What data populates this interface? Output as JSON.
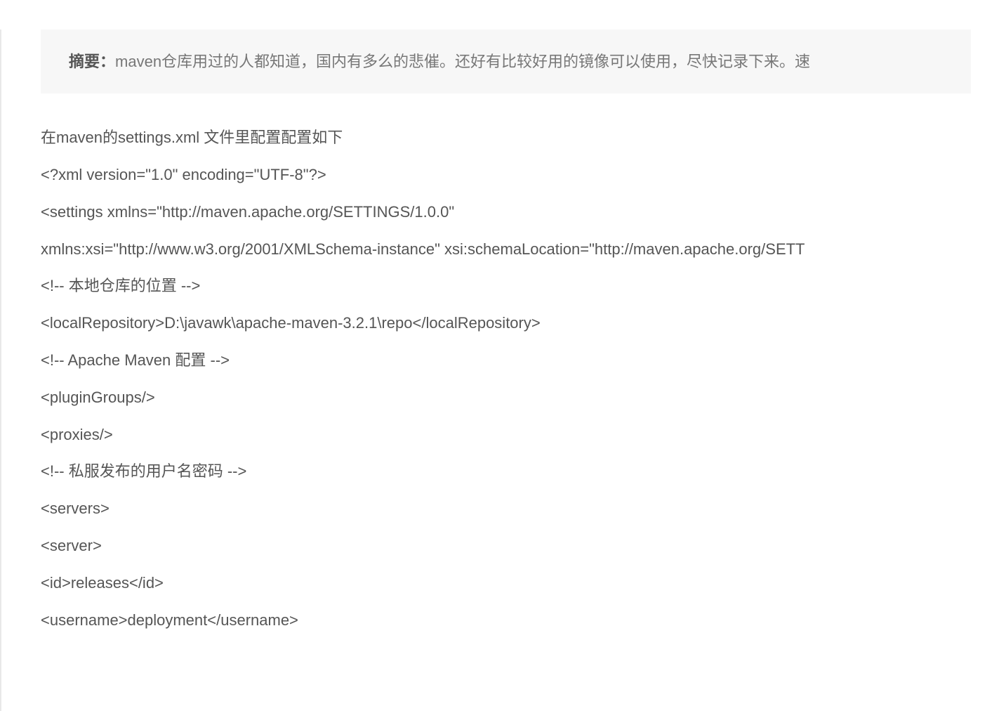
{
  "abstract": {
    "label": "摘要：",
    "text": "maven仓库用过的人都知道，国内有多么的悲催。还好有比较好用的镜像可以使用，尽快记录下来。速"
  },
  "lines": [
    "在maven的settings.xml 文件里配置配置如下",
    "<?xml version=\"1.0\" encoding=\"UTF-8\"?>",
    "<settings xmlns=\"http://maven.apache.org/SETTINGS/1.0.0\"",
    "xmlns:xsi=\"http://www.w3.org/2001/XMLSchema-instance\" xsi:schemaLocation=\"http://maven.apache.org/SETT",
    "<!-- 本地仓库的位置 -->",
    "<localRepository>D:\\javawk\\apache-maven-3.2.1\\repo</localRepository>",
    "<!-- Apache Maven 配置 -->",
    "<pluginGroups/>",
    "<proxies/>",
    "<!-- 私服发布的用户名密码 -->",
    "<servers>",
    "<server>",
    "<id>releases</id>",
    "<username>deployment</username>"
  ]
}
